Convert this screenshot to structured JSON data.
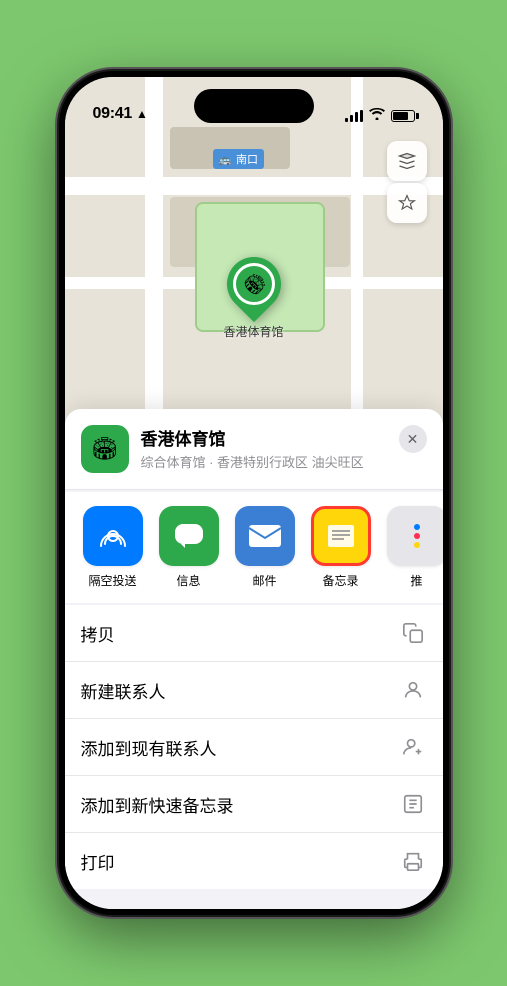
{
  "status_bar": {
    "time": "09:41",
    "location_arrow": "▶"
  },
  "map": {
    "label": "南口",
    "marker_name": "香港体育馆",
    "marker_emoji": "🏟"
  },
  "map_controls": {
    "layers_icon": "🗺",
    "location_icon": "⬆"
  },
  "location_card": {
    "icon_emoji": "🏟",
    "name": "香港体育馆",
    "subtitle": "综合体育馆 · 香港特别行政区 油尖旺区",
    "close_label": "✕"
  },
  "share_items": [
    {
      "id": "airdrop",
      "label": "隔空投送",
      "emoji": "📡",
      "bg": "#007aff",
      "selected": false
    },
    {
      "id": "messages",
      "label": "信息",
      "emoji": "💬",
      "bg": "#2da84a",
      "selected": false
    },
    {
      "id": "mail",
      "label": "邮件",
      "emoji": "✉",
      "bg": "#3b7fd4",
      "selected": false
    },
    {
      "id": "notes",
      "label": "备忘录",
      "emoji": "📝",
      "bg": "#ffd60a",
      "selected": true
    },
    {
      "id": "more",
      "label": "推",
      "emoji": "⋯",
      "bg": "#e5e5ea",
      "selected": false
    }
  ],
  "actions": [
    {
      "id": "copy",
      "label": "拷贝",
      "icon": "copy"
    },
    {
      "id": "add-contact",
      "label": "新建联系人",
      "icon": "person"
    },
    {
      "id": "add-existing",
      "label": "添加到现有联系人",
      "icon": "person-add"
    },
    {
      "id": "add-note",
      "label": "添加到新快速备忘录",
      "icon": "note"
    },
    {
      "id": "print",
      "label": "打印",
      "icon": "print"
    }
  ]
}
